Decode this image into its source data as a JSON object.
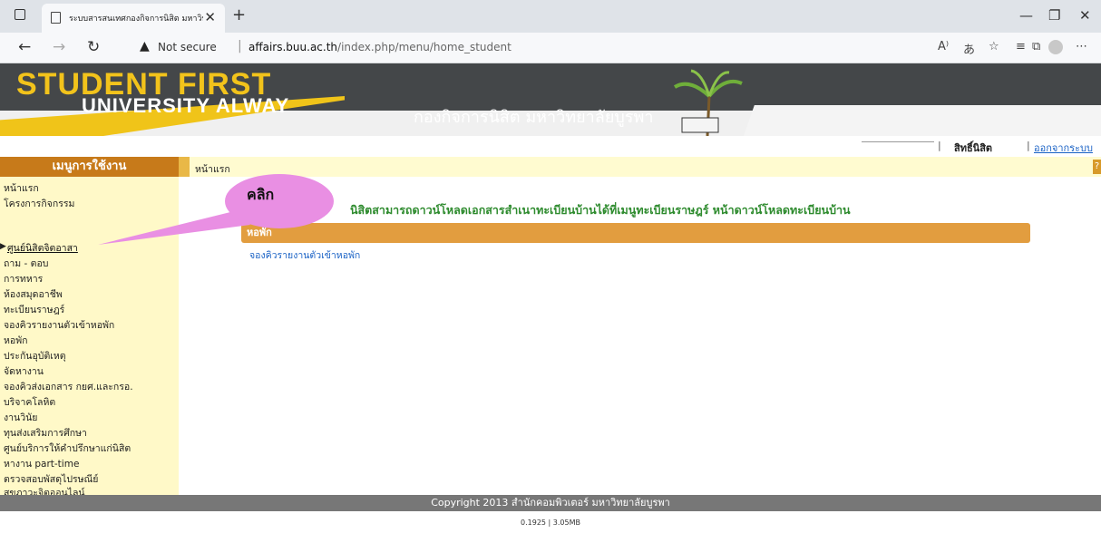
{
  "browser": {
    "tab_title": "ระบบสารสนเทศกองกิจการนิสิต มหาวิท",
    "new_tab": "+",
    "not_secure": "Not secure",
    "url_host": "affairs.buu.ac.th",
    "url_path": "/index.php/menu/home_student"
  },
  "banner": {
    "brand_line1": "STUDENT FIRST",
    "brand_line2": "UNIVERSITY ALWAY",
    "org_name": "กองกิจการนิสิต มหาวิทยาลัยบูรพา"
  },
  "userbar": {
    "pipe": "|",
    "rights": "สิทธิ์นิสิต",
    "logout": "ออกจากระบบ"
  },
  "menu": {
    "title": "เมนูการใช้งาน",
    "items": [
      "หน้าแรก",
      "โครงการกิจกรรม",
      "ศูนย์นิสิตจิตอาสา",
      "ถาม - ตอบ",
      "การทหาร",
      "ห้องสมุดอาชีพ",
      "ทะเบียนราษฎร์",
      "จองคิวรายงานตัวเข้าหอพัก",
      "หอพัก",
      "ประกันอุบัติเหตุ",
      "จัดหางาน",
      "จองคิวส่งเอกสาร กยศ.และกรอ.",
      "บริจาคโลหิต",
      "งานวินัย",
      "ทุนส่งเสริมการศึกษา",
      "ศูนย์บริการให้คำปรึกษาแก่นิสิต",
      "หางาน part-time",
      "ตรวจสอบพัสดุไปรษณีย์",
      "สุขภาวะจิตออนไลน์"
    ]
  },
  "breadcrumb": "หน้าแรก",
  "help": "?",
  "content": {
    "notice": "นิสิตสามารถดาวน์โหลดเอกสารสำเนาทะเบียนบ้านได้ที่เมนูทะเบียนราษฎร์ หน้าดาวน์โหลดทะเบียนบ้าน",
    "section_title": "หอพัก",
    "section_link": "จองคิวรายงานตัวเข้าหอพัก"
  },
  "annotation": {
    "text": "คลิก"
  },
  "footer": {
    "copyright": "Copyright 2013    สำนักคอมพิวเตอร์ มหาวิทยาลัยบูรพา",
    "stats": "0.1925 | 3.05MB"
  }
}
